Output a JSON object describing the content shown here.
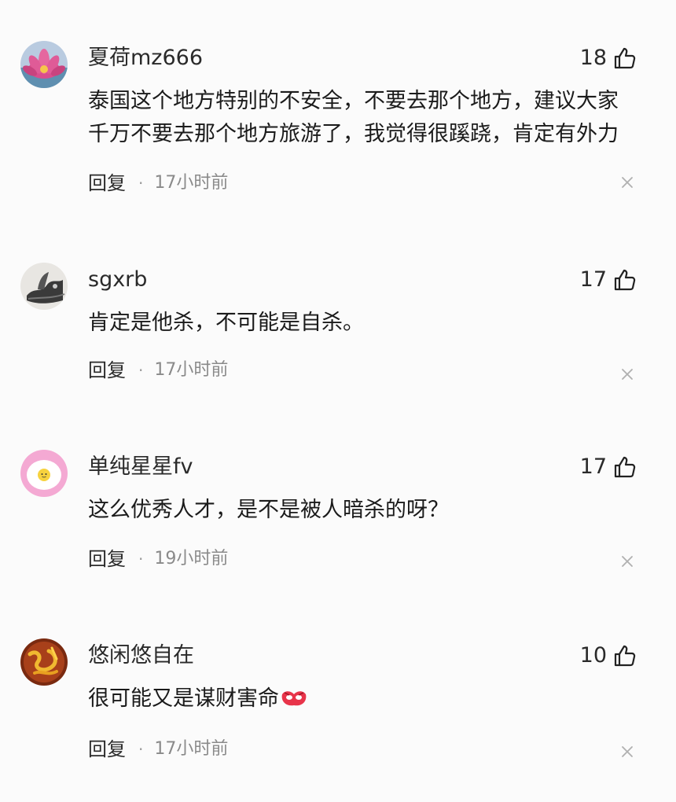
{
  "comments": [
    {
      "username": "夏荷mz666",
      "likes": "18",
      "lines": [
        "泰国这个地方特别的不安全，不要去那个地方，建议大家",
        "千万不要去那个地方旅游了，我觉得很蹊跷，肯定有外力"
      ],
      "reply_label": "回复",
      "separator": "·",
      "time": "17小时前",
      "avatar_icon": "lotus-avatar-icon"
    },
    {
      "username": "sgxrb",
      "likes": "17",
      "lines": [
        "肯定是他杀，不可能是自杀。"
      ],
      "reply_label": "回复",
      "separator": "·",
      "time": "17小时前",
      "avatar_icon": "ink-painting-avatar-icon"
    },
    {
      "username": "单纯星星fv",
      "likes": "17",
      "lines": [
        "这么优秀人才，是不是被人暗杀的呀？"
      ],
      "reply_label": "回复",
      "separator": "·",
      "time": "19小时前",
      "avatar_icon": "egg-avatar-icon"
    },
    {
      "username": "悠闲悠自在",
      "likes": "10",
      "lines": [
        "很可能又是谋财害命"
      ],
      "reply_label": "回复",
      "separator": "·",
      "time": "17小时前",
      "avatar_icon": "golden-calligraphy-avatar-icon",
      "trailing_emoji": "red-mask-emoji-icon"
    }
  ],
  "colors": {
    "background": "#fbfbfb",
    "text": "#1b1b1b",
    "muted": "#8a8a8a"
  }
}
